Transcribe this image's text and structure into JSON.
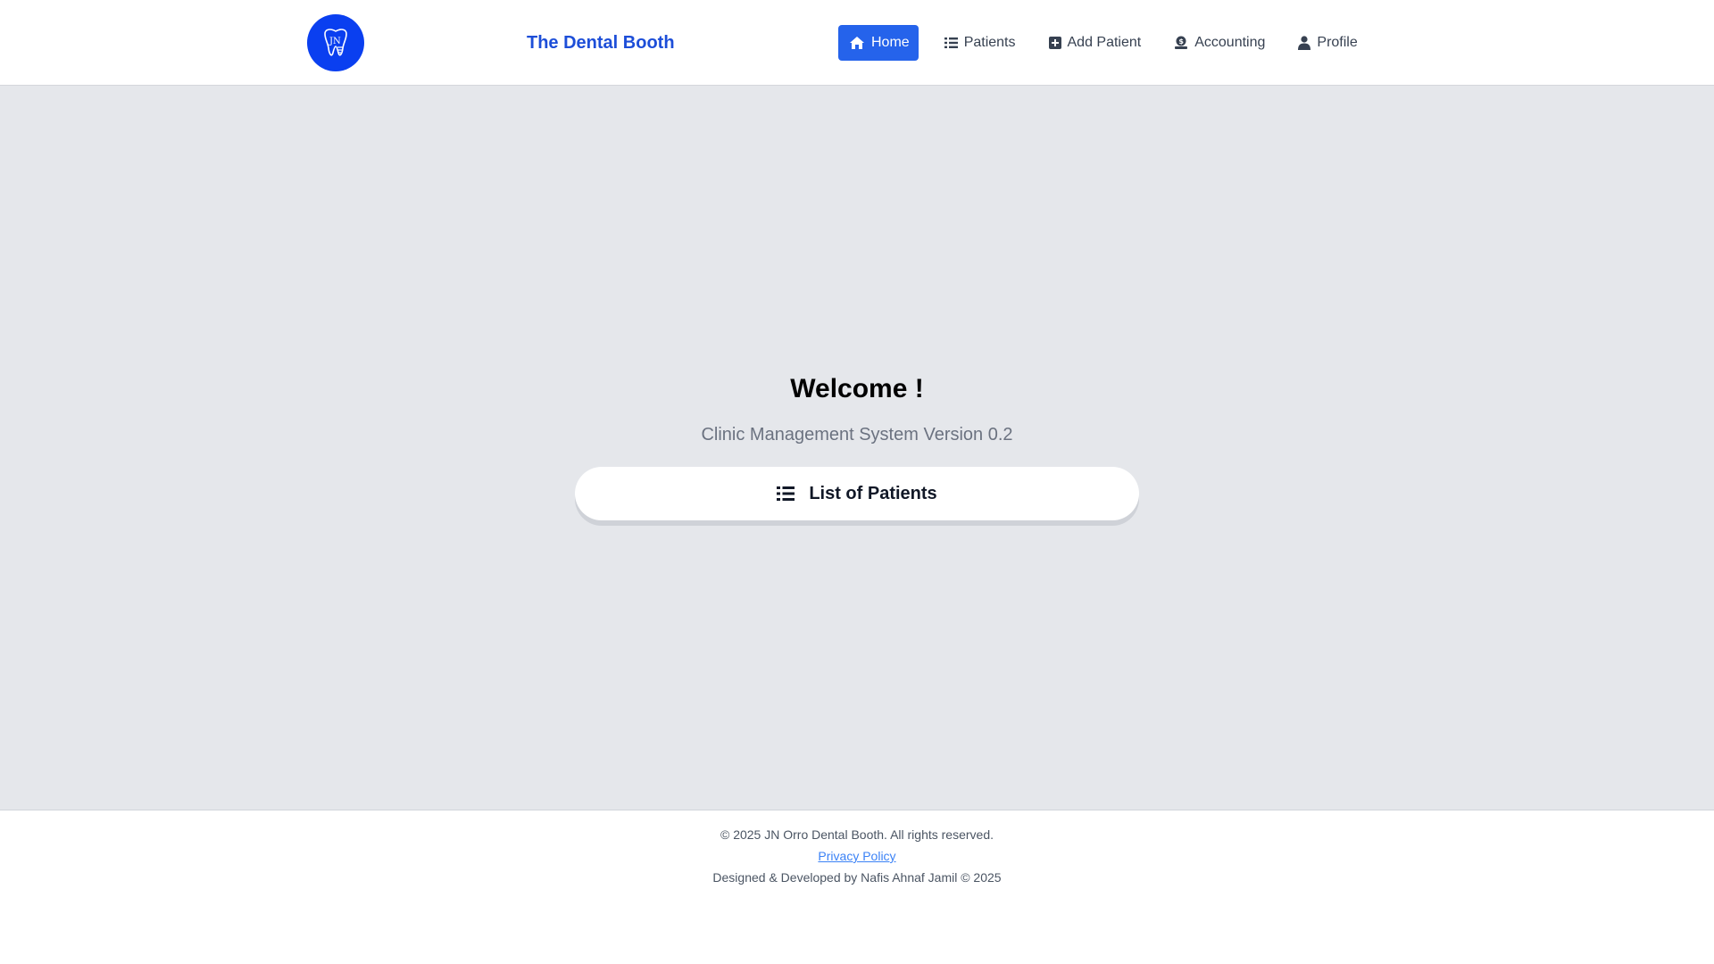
{
  "header": {
    "logo_icon": "tooth-jn-logo-icon",
    "logo_text": "JN",
    "brand": "The Dental Booth",
    "nav": [
      {
        "label": "Home",
        "icon": "home-icon",
        "active": true
      },
      {
        "label": "Patients",
        "icon": "list-icon",
        "active": false
      },
      {
        "label": "Add Patient",
        "icon": "plus-square-icon",
        "active": false
      },
      {
        "label": "Accounting",
        "icon": "money-icon",
        "active": false
      },
      {
        "label": "Profile",
        "icon": "user-icon",
        "active": false
      }
    ]
  },
  "main": {
    "welcome": "Welcome !",
    "subtitle": "Clinic Management System Version 0.2",
    "list_button": {
      "label": "List of Patients",
      "icon": "list-icon"
    }
  },
  "footer": {
    "copyright": "© 2025 JN Orro Dental Booth. All rights reserved.",
    "privacy": "Privacy Policy",
    "credit": "Designed & Developed by Nafis Ahnaf Jamil © 2025"
  },
  "colors": {
    "accent": "#2563eb",
    "brand_text": "#1d4ed8",
    "logo_bg": "#0a3ff0",
    "main_bg": "#e5e7eb"
  }
}
